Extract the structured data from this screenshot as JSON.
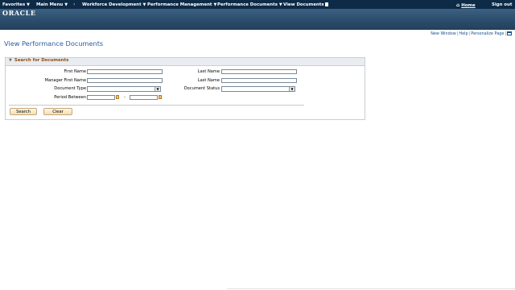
{
  "nav": {
    "favorites": "Favorites",
    "main_menu": "Main Menu",
    "workforce_development": "Workforce Development",
    "performance_management": "Performance Management",
    "performance_documents": "Performance Documents",
    "view_documents": "View Documents",
    "home": "Home",
    "sign_out": "Sign out"
  },
  "brand": {
    "logo": "ORACLE"
  },
  "page_links": {
    "new_window": "New Window",
    "help": "Help",
    "personalize": "Personalize Page"
  },
  "page": {
    "title": "View Performance Documents"
  },
  "search": {
    "header": "Search for Documents",
    "first_name_label": "First Name",
    "first_name_value": "",
    "last_name_label": "Last Name",
    "last_name_value": "",
    "manager_first_name_label": "Manager First Name",
    "manager_first_name_value": "",
    "manager_last_name_label": "Last Name",
    "manager_last_name_value": "",
    "document_type_label": "Document Type",
    "document_type_value": "",
    "document_status_label": "Document Status",
    "document_status_value": "",
    "period_between_label": "Period Between",
    "period_from_value": "",
    "period_to_value": "",
    "period_dash": "-",
    "search_button": "Search",
    "clear_button": "Clear"
  },
  "colors": {
    "nav_bg": "#0d2a47",
    "banner": "#2a4b6a",
    "link": "#1b4e8a",
    "title": "#2b5da0",
    "section_header": "#8a4e12"
  }
}
